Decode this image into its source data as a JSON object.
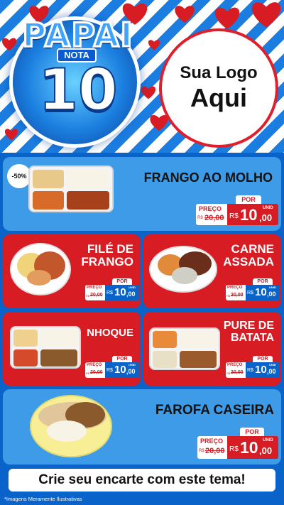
{
  "header": {
    "badge_title": "PAPAI",
    "badge_nota": "NOTA",
    "badge_number": "10",
    "logo_line1": "Sua Logo",
    "logo_line2": "Aqui"
  },
  "products": [
    {
      "name_lines": [
        "FRANGO AO MOLHO"
      ],
      "discount": "-50%",
      "preco_label": "PREÇO",
      "old_prefix": "R$",
      "old_price": "20,00",
      "por_label": "POR",
      "new_prefix": "R$",
      "new_int": "10",
      "new_dec": ",00",
      "unit": "UNID"
    },
    {
      "name_lines": [
        "FILÉ DE",
        "FRANGO"
      ],
      "preco_label": "PREÇO",
      "old_prefix": "R$",
      "old_price": "20,00",
      "por_label": "POR",
      "new_prefix": "R$",
      "new_int": "10",
      "new_dec": ",00",
      "unit": "UNID"
    },
    {
      "name_lines": [
        "CARNE",
        "ASSADA"
      ],
      "preco_label": "PREÇO",
      "old_prefix": "R$",
      "old_price": "20,00",
      "por_label": "POR",
      "new_prefix": "R$",
      "new_int": "10",
      "new_dec": ",00",
      "unit": "UNID"
    },
    {
      "name_lines": [
        "NHOQUE"
      ],
      "preco_label": "PREÇO",
      "old_prefix": "R$",
      "old_price": "20,00",
      "por_label": "POR",
      "new_prefix": "R$",
      "new_int": "10",
      "new_dec": ",00",
      "unit": "UNID"
    },
    {
      "name_lines": [
        "PURE DE",
        "BATATA"
      ],
      "preco_label": "PREÇO",
      "old_prefix": "R$",
      "old_price": "20,00",
      "por_label": "POR",
      "new_prefix": "R$",
      "new_int": "10",
      "new_dec": ",00",
      "unit": "UNID"
    },
    {
      "name_lines": [
        "FAROFA CASEIRA"
      ],
      "preco_label": "PREÇO",
      "old_prefix": "R$",
      "old_price": "20,00",
      "por_label": "POR",
      "new_prefix": "R$",
      "new_int": "10",
      "new_dec": ",00",
      "unit": "UNID"
    }
  ],
  "cta": "Crie seu encarte com este tema!",
  "footnote": "*Imagens Meramente Ilustrativas",
  "colors": {
    "blue_card": "#3d9be8",
    "red_card": "#d81c24",
    "background": "#0a63c8",
    "heart": "#d81c24"
  }
}
